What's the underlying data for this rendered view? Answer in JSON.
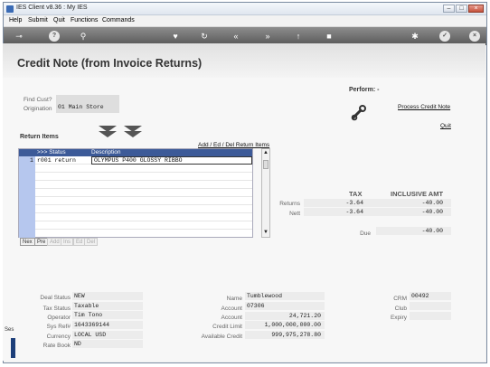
{
  "window": {
    "title": "IES Client v8.36 : My IES"
  },
  "menu": [
    "Help",
    "Submit",
    "Quit",
    "Functions",
    "Commands"
  ],
  "page_title": "Credit Note (from Invoice Returns)",
  "find_cust": {
    "label": "Find Cust?",
    "value": ""
  },
  "origination": {
    "label": "Origination",
    "value": "01 Main Store"
  },
  "perform": {
    "label": "Perform: -",
    "process_link": "Process Credit Note",
    "quit_link": "Quit"
  },
  "return_items": {
    "label": "Return Items",
    "add_edit_link": "Add / Ed / Del Return Items",
    "columns": [
      ">>> Status",
      "Description"
    ],
    "rows": [
      {
        "num": "1",
        "status": "r001 return",
        "description": "OLYMPUS P400 GLOSSY RIBBO"
      }
    ],
    "buttons": [
      "Nex",
      "Pre",
      "Add",
      "Ins",
      "Ed",
      "Del"
    ]
  },
  "totals": {
    "tax_header": "TAX",
    "incl_header": "INCLUSIVE AMT",
    "returns_label": "Returns",
    "returns_tax": "-3.64",
    "returns_incl": "-40.00",
    "nett_label": "Nett",
    "nett_tax": "-3.64",
    "nett_incl": "-40.00",
    "due_label": "Due",
    "due_value": "-40.00"
  },
  "left_block": {
    "deal_status_label": "Deal Status",
    "deal_status": "NEW",
    "tax_status_label": "Tax Status",
    "tax_status": "Taxable",
    "operator_label": "Operator",
    "operator": "Tim Tono",
    "sys_ref_label": "Sys Ref#",
    "sys_ref": "1643369144",
    "currency_label": "Currency",
    "currency": "LOCAL USD",
    "rate_book_label": "Rate Book",
    "rate_book": "ND"
  },
  "mid_block": {
    "name_label": "Name",
    "name": "Tumblewood",
    "account_label": "Account",
    "account": "07306",
    "account2_label": "Account",
    "account2": "24,721.20",
    "credit_limit_label": "Credit Limit",
    "credit_limit": "1,000,000,000.00",
    "available_label": "Available Credit",
    "available": "999,975,278.80"
  },
  "right_block": {
    "crm_label": "CRM",
    "crm": "00492",
    "club_label": "Club",
    "club": "",
    "expiry_label": "Expiry",
    "expiry": ""
  },
  "left_edge_text": "Ses"
}
